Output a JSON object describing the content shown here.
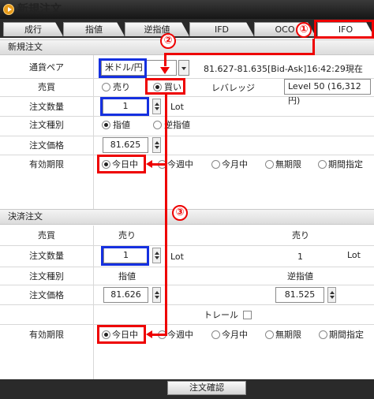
{
  "window": {
    "title": "新規注文"
  },
  "tabs": [
    {
      "label": "成行"
    },
    {
      "label": "指値"
    },
    {
      "label": "逆指値"
    },
    {
      "label": "IFD"
    },
    {
      "label": "OCO"
    },
    {
      "label": "IFO",
      "active": true
    }
  ],
  "new_order": {
    "section_title": "新規注文",
    "currency_pair": {
      "label": "通貨ペア",
      "value": "米ドル/円",
      "quote": "81.627-81.635[Bid-Ask]16:42:29現在"
    },
    "trade": {
      "label": "売買",
      "options": [
        "売り",
        "買い"
      ],
      "selected": "買い"
    },
    "leverage": {
      "label": "レバレッジ",
      "value": "Level 50 (16,312円)"
    },
    "quantity": {
      "label": "注文数量",
      "value": "1",
      "unit": "Lot"
    },
    "order_type": {
      "label": "注文種別",
      "options": [
        "指値",
        "逆指値"
      ],
      "selected": "指値"
    },
    "price": {
      "label": "注文価格",
      "value": "81.625"
    },
    "expiry": {
      "label": "有効期限",
      "options": [
        "今日中",
        "今週中",
        "今月中",
        "無期限",
        "期間指定"
      ],
      "selected": "今日中"
    }
  },
  "settle_order": {
    "section_title": "決済注文",
    "trade": {
      "label": "売買",
      "left": "売り",
      "right": "売り"
    },
    "quantity": {
      "label": "注文数量",
      "value": "1",
      "unit": "Lot",
      "right_value": "1",
      "right_unit": "Lot"
    },
    "order_type": {
      "label": "注文種別",
      "left": "指値",
      "right": "逆指値"
    },
    "price": {
      "label": "注文価格",
      "left_value": "81.626",
      "right_value": "81.525"
    },
    "trail": {
      "label": "トレール"
    },
    "expiry": {
      "label": "有効期限",
      "options": [
        "今日中",
        "今週中",
        "今月中",
        "無期限",
        "期間指定"
      ],
      "selected": "今日中"
    }
  },
  "confirm_button": {
    "label": "注文確認"
  },
  "annotations": {
    "m1": "①",
    "m2": "②",
    "m3": "③"
  },
  "colors": {
    "highlight_red": "#e00000",
    "highlight_blue": "#1530e0",
    "title_bar": "#1e1e1e"
  }
}
